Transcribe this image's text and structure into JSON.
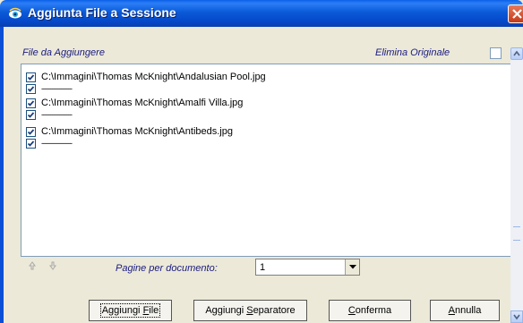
{
  "window": {
    "title": "Aggiunta File a Sessione"
  },
  "header": {
    "files_label": "File da Aggiungere",
    "delete_original_label": "Elimina Originale"
  },
  "files": [
    {
      "path": "C:\\Immagini\\Thomas McKnight\\Andalusian Pool.jpg",
      "checked": true,
      "separator": "-----------------"
    },
    {
      "path": "C:\\Immagini\\Thomas McKnight\\Amalfi Villa.jpg",
      "checked": true,
      "separator": "-----------------"
    },
    {
      "path": "C:\\Immagini\\Thomas McKnight\\Antibeds.jpg",
      "checked": true,
      "separator": "-----------------"
    }
  ],
  "pages": {
    "label": "Pagine per documento:",
    "value": "1"
  },
  "buttons": {
    "add_file": {
      "pre": "Aggiungi ",
      "key": "F",
      "post": "ile"
    },
    "add_separator": {
      "pre": "Aggiungi ",
      "key": "S",
      "post": "eparatore"
    },
    "confirm": {
      "pre": "",
      "key": "C",
      "post": "onferma"
    },
    "cancel": {
      "pre": "",
      "key": "A",
      "post": "nnulla"
    }
  },
  "colors": {
    "title_blue": "#0548c9",
    "label_blue": "#1a1a80"
  },
  "icons": {
    "title": "eye-icon",
    "close": "close-icon",
    "move_up": "arrow-up-icon",
    "move_down": "arrow-down-icon"
  }
}
